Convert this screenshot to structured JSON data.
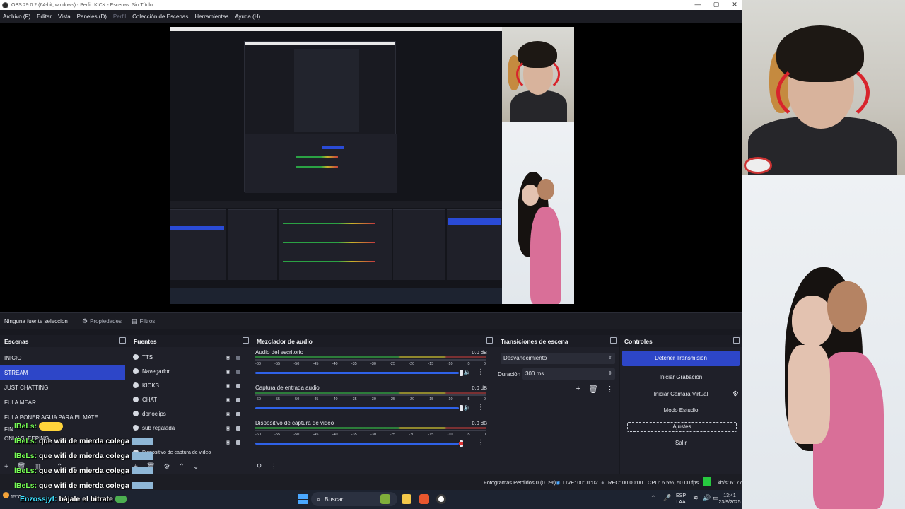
{
  "window": {
    "title": "OBS 29.0.2 (64-bit, windows) - Perfil: KICK - Escenas: Sin Título",
    "minimize": "—",
    "maximize": "▢",
    "close": "✕"
  },
  "menu": [
    {
      "label": "Archivo (F)",
      "dim": false
    },
    {
      "label": "Editar",
      "dim": false
    },
    {
      "label": "Vista",
      "dim": false
    },
    {
      "label": "Paneles (D)",
      "dim": false
    },
    {
      "label": "Perfil",
      "dim": true
    },
    {
      "label": "Colección de Escenas",
      "dim": false
    },
    {
      "label": "Herramientas",
      "dim": false
    },
    {
      "label": "Ayuda (H)",
      "dim": false
    }
  ],
  "source_toolbar": {
    "no_source": "Ninguna fuente seleccionada",
    "properties": "Propiedades",
    "filters": "Filtros"
  },
  "scenes": {
    "title": "Escenas",
    "items": [
      {
        "label": "INICIO",
        "active": false
      },
      {
        "label": "STREAM",
        "active": true
      },
      {
        "label": "JUST CHATTING",
        "active": false
      },
      {
        "label": "FUI A MEAR",
        "active": false
      },
      {
        "label": "FUI A PONER AGUA PARA EL MATE",
        "active": false
      },
      {
        "label": "FIN",
        "active": false
      },
      {
        "label": "ONLY SLEEPING",
        "active": false
      }
    ]
  },
  "sources": {
    "title": "Fuentes",
    "items": [
      {
        "label": "TTS",
        "locked": false
      },
      {
        "label": "Navegador",
        "locked": false
      },
      {
        "label": "KICKS",
        "locked": true
      },
      {
        "label": "CHAT",
        "locked": true
      },
      {
        "label": "donoclips",
        "locked": true
      },
      {
        "label": "sub regalada",
        "locked": true
      },
      {
        "label": "s",
        "locked": true
      },
      {
        "label": "Dispositivo de captura de video",
        "locked": true
      }
    ]
  },
  "mixer": {
    "title": "Mezclador de audio",
    "scale": [
      "-60",
      "-55",
      "-50",
      "-45",
      "-40",
      "-35",
      "-30",
      "-25",
      "-20",
      "-15",
      "-10",
      "-5",
      "0"
    ],
    "channels": [
      {
        "name": "Audio del escritorio",
        "db": "0.0 dB",
        "volume": 0.95,
        "muted": false
      },
      {
        "name": "Captura de entrada audio",
        "db": "0.0 dB",
        "volume": 0.95,
        "muted": false
      },
      {
        "name": "Dispositivo de captura de video",
        "db": "0.0 dB",
        "volume": 0.95,
        "muted": true
      }
    ]
  },
  "transitions": {
    "title": "Transiciones de escena",
    "selected": "Desvanecimiento",
    "duration_label": "Duración",
    "duration_value": "300 ms"
  },
  "controls": {
    "title": "Controles",
    "stop_stream": "Detener Transmisión",
    "start_recording": "Iniciar Grabación",
    "start_virtual_cam": "Iniciar Cámara Virtual",
    "studio_mode": "Modo Estudio",
    "settings": "Ajustes",
    "exit": "Salir"
  },
  "status": {
    "dropped": "Fotogramas Perdidos 0 (0.0%)",
    "live": "LIVE: 00:01:02",
    "rec": "REC: 00:00:00",
    "cpu": "CPU: 6.5%, 50.00 fps",
    "kbps": "kb/s: 6177"
  },
  "chat": [
    {
      "user": "lBeLs:",
      "msg": ""
    },
    {
      "user": "lBeLs:",
      "msg": "que wifi de mierda colega"
    },
    {
      "user": "lBeLs:",
      "msg": "que wifi de mierda colega"
    },
    {
      "user": "lBeLs:",
      "msg": "que wifi de mierda colega"
    },
    {
      "user": "lBeLs:",
      "msg": "que wifi de mierda colega"
    },
    {
      "user": "Enzossjyf:",
      "msg": "bájale el bitrate"
    }
  ],
  "taskbar": {
    "search": "Buscar",
    "lang": "ESP",
    "lang2": "LAA",
    "time": "13:41",
    "date": "23/9/2025",
    "temp": "15°C"
  },
  "colors": {
    "accent": "#2d46c8",
    "panel": "#1f2029",
    "status_green": "#27c93f"
  }
}
